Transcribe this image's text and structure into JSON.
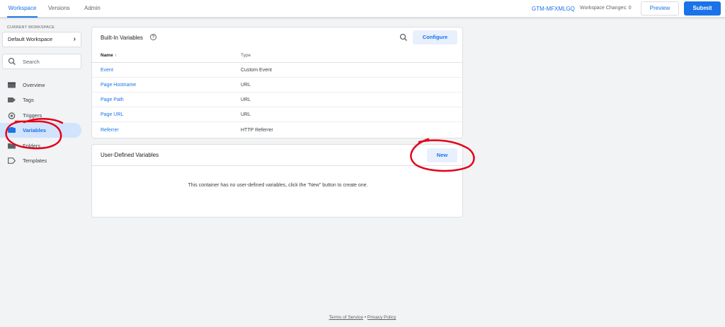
{
  "topbar": {
    "tabs": [
      {
        "label": "Workspace",
        "active": true
      },
      {
        "label": "Versions",
        "active": false
      },
      {
        "label": "Admin",
        "active": false
      }
    ],
    "container_id": "GTM-MFXMLGQ",
    "workspace_changes": "Workspace Changes: 0",
    "preview_label": "Preview",
    "submit_label": "Submit"
  },
  "sidebar": {
    "workspace_label": "CURRENT WORKSPACE",
    "workspace_name": "Default Workspace",
    "search_placeholder": "Search",
    "items": [
      {
        "label": "Overview",
        "icon": "overview-icon",
        "active": false
      },
      {
        "label": "Tags",
        "icon": "tag-icon",
        "active": false
      },
      {
        "label": "Triggers",
        "icon": "trigger-icon",
        "active": false
      },
      {
        "label": "Variables",
        "icon": "variables-icon",
        "active": true
      },
      {
        "label": "Folders",
        "icon": "folder-icon",
        "active": false
      },
      {
        "label": "Templates",
        "icon": "template-icon",
        "active": false
      }
    ]
  },
  "builtin": {
    "title": "Built-In Variables",
    "configure_label": "Configure",
    "columns": {
      "name": "Name ↑",
      "type": "Type"
    },
    "rows": [
      {
        "name": "Event",
        "type": "Custom Event"
      },
      {
        "name": "Page Hostname",
        "type": "URL"
      },
      {
        "name": "Page Path",
        "type": "URL"
      },
      {
        "name": "Page URL",
        "type": "URL"
      },
      {
        "name": "Referrer",
        "type": "HTTP Referrer"
      }
    ]
  },
  "user_defined": {
    "title": "User-Defined Variables",
    "new_label": "New",
    "empty_message": "This container has no user-defined variables, click the \"New\" button to create one."
  },
  "footer": {
    "terms": "Terms of Service",
    "separator": "•",
    "privacy": "Privacy Policy"
  },
  "colors": {
    "accent": "#1a73e8",
    "active_nav_bg": "#d2e3fc",
    "annotation": "#e3001b"
  }
}
